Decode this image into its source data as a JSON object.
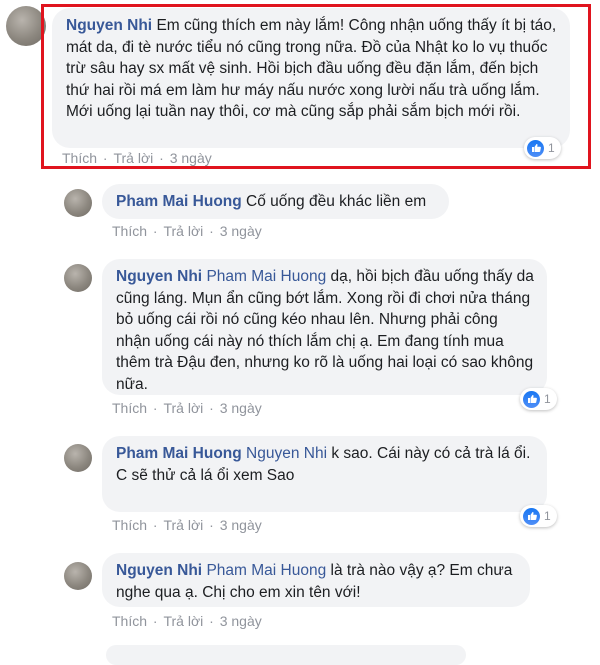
{
  "comments": [
    {
      "author": "Nguyen Nhi",
      "mention": "",
      "text": "Em cũng thích em này lắm! Công nhận uống thấy ít bị táo, mát da, đi tè nước tiểu nó cũng trong nữa. Đồ của Nhật ko lo vụ thuốc trừ sâu hay sx mất vệ sinh. Hồi bịch đầu uống đều đặn lắm, đến bịch thứ hai rồi má em làm hư máy nấu nước xong lười nấu trà uống lắm. Mới uống lại tuần nay thôi, cơ mà cũng sắp phải sắm bịch mới rồi.",
      "like": "Thích",
      "reply": "Trả lời",
      "time": "3 ngày",
      "reactions": "1"
    },
    {
      "author": "Pham Mai Huong",
      "mention": "",
      "text": "Cố uống đều khác liền em",
      "like": "Thích",
      "reply": "Trả lời",
      "time": "3 ngày",
      "reactions": ""
    },
    {
      "author": "Nguyen Nhi",
      "mention": "Pham Mai Huong",
      "text": "dạ, hồi bịch đầu uống thấy da cũng láng. Mụn ẩn cũng bớt lắm. Xong rồi đi chơi nửa tháng bỏ uống cái rồi nó cũng kéo nhau lên. Nhưng phải công nhận uống cái này nó thích lắm chị ạ. Em đang tính mua thêm trà Đậu đen, nhưng ko rõ là uống hai loại có sao không nữa.",
      "like": "Thích",
      "reply": "Trả lời",
      "time": "3 ngày",
      "reactions": "1"
    },
    {
      "author": "Pham Mai Huong",
      "mention": "Nguyen Nhi",
      "text": "k sao. Cái này có cả trà lá ổi. C sẽ thử cả lá ổi xem Sao",
      "like": "Thích",
      "reply": "Trả lời",
      "time": "3 ngày",
      "reactions": "1"
    },
    {
      "author": "Nguyen Nhi",
      "mention": "Pham Mai Huong",
      "text": "là trà nào vậy ạ? Em chưa nghe qua ạ. Chị cho em xin tên với!",
      "like": "Thích",
      "reply": "Trả lời",
      "time": "3 ngày",
      "reactions": ""
    }
  ],
  "actions_separator": "·",
  "icons": {
    "reaction": "like-thumb-icon"
  },
  "colors": {
    "name": "#385898",
    "bubble": "#f2f3f5",
    "highlight": "#e0141e",
    "like": "#1877f2"
  }
}
